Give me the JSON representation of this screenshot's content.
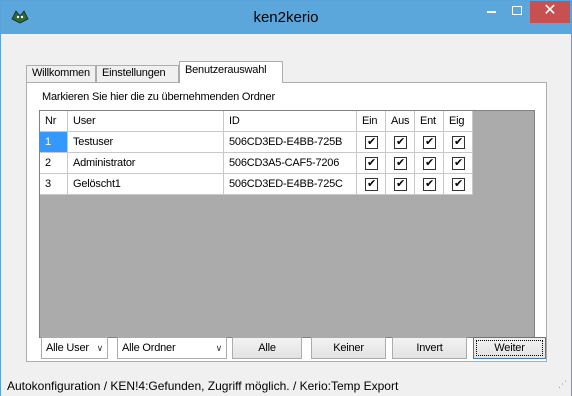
{
  "window": {
    "title": "ken2kerio",
    "icon": "bat-logo-icon",
    "controls": {
      "minimize": "minimize-icon",
      "maximize": "maximize-icon",
      "close": "✕"
    }
  },
  "tabs": [
    {
      "label": "Willkommen"
    },
    {
      "label": "Einstellungen"
    },
    {
      "label": "Benutzerauswahl",
      "active": true
    }
  ],
  "panel": {
    "instruction": "Markieren Sie hier die zu übernehmenden Ordner"
  },
  "grid": {
    "columns": {
      "nr": "Nr",
      "user": "User",
      "id": "ID",
      "ein": "Ein",
      "aus": "Aus",
      "ent": "Ent",
      "eig": "Eig"
    },
    "rows": [
      {
        "nr": "1",
        "user": "Testuser",
        "id": "506CD3ED-E4BB-725B",
        "ein": true,
        "aus": true,
        "ent": true,
        "eig": true,
        "selected": true
      },
      {
        "nr": "2",
        "user": "Administrator",
        "id": "506CD3A5-CAF5-7206",
        "ein": true,
        "aus": true,
        "ent": true,
        "eig": true
      },
      {
        "nr": "3",
        "user": "Gelöscht1",
        "id": "506CD3ED-E4BB-725C",
        "ein": true,
        "aus": true,
        "ent": true,
        "eig": true
      }
    ],
    "check_glyph": "✔"
  },
  "controls": {
    "user_select": "Alle User",
    "ordner_select": "Alle Ordner",
    "dropdown_arrow": "∨",
    "alle": "Alle",
    "keiner": "Keiner",
    "invert": "Invert",
    "weiter": "Weiter"
  },
  "status": {
    "text": "Autokonfiguration / KEN!4:Gefunden, Zugriff möglich. / Kerio:Temp Export"
  },
  "colors": {
    "titlebar": "#5ba6db",
    "close": "#c75050",
    "selection": "#3399ff"
  }
}
